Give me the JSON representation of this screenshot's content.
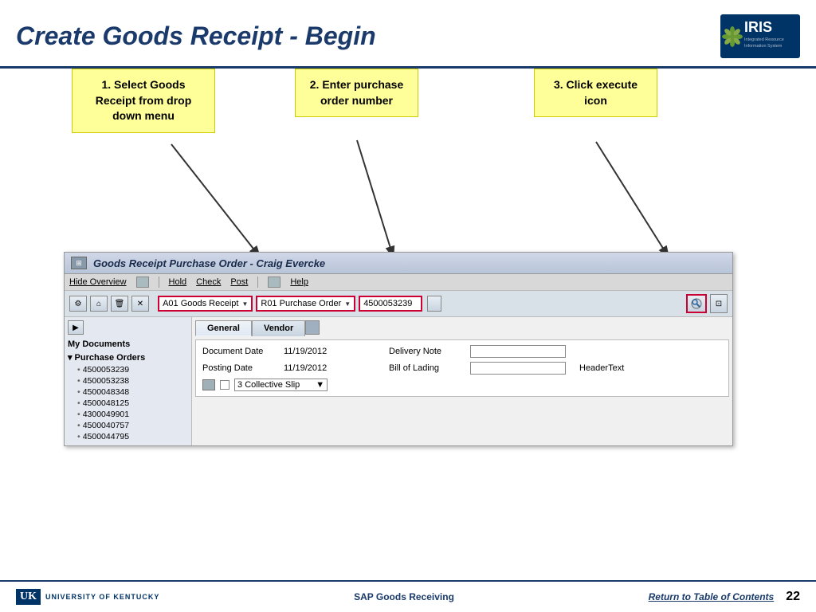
{
  "header": {
    "title": "Create Goods Receipt - Begin",
    "logo_text": "IRIS",
    "logo_sub": "Integrated Resource Information System"
  },
  "callouts": {
    "callout1": "1. Select Goods Receipt from drop down menu",
    "callout2": "2. Enter purchase order number",
    "callout3": "3. Click execute icon"
  },
  "sap": {
    "titlebar": "Goods Receipt Purchase Order - Craig Evercke",
    "menubar": {
      "hide_overview": "Hide Overview",
      "hold": "Hold",
      "check": "Check",
      "post": "Post",
      "help": "Help"
    },
    "toolbar": {
      "dropdown1": "A01 Goods Receipt",
      "dropdown2": "R01 Purchase Order",
      "po_number": "4500053239"
    },
    "sidebar": {
      "title": "My Documents",
      "section": "Purchase Orders",
      "items": [
        "4500053239",
        "4500053238",
        "4500048348",
        "4500048125",
        "4300049901",
        "4500040757",
        "4500044795"
      ]
    },
    "tabs": {
      "general": "General",
      "vendor": "Vendor"
    },
    "form": {
      "doc_date_label": "Document Date",
      "doc_date_value": "11/19/2012",
      "posting_date_label": "Posting Date",
      "posting_date_value": "11/19/2012",
      "delivery_note_label": "Delivery Note",
      "bill_lading_label": "Bill of Lading",
      "header_text_label": "HeaderText",
      "slip_count": "3",
      "slip_type": "Collective Slip"
    }
  },
  "footer": {
    "uk_abbr": "UK",
    "uk_full": "University of Kentucky",
    "center_text": "SAP Goods Receiving",
    "return_link": "Return to Table of Contents",
    "page_number": "22"
  }
}
